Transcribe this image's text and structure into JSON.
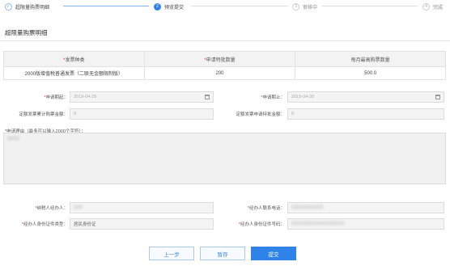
{
  "steps": [
    {
      "num": "✓",
      "label": "超限量购票明细",
      "state": "done"
    },
    {
      "num": "2",
      "label": "预览提交",
      "state": "active"
    },
    {
      "num": "3",
      "label": "审核中",
      "state": "todo"
    },
    {
      "num": "4",
      "label": "完成",
      "state": "todo"
    }
  ],
  "page_title": "超限量购票明细",
  "table": {
    "headers": [
      "发票种类",
      "申请特批数量",
      "每月最高购票数量"
    ],
    "header_required": [
      true,
      true,
      false
    ],
    "rows": [
      [
        "2000版增值税普通发票（二联无金额限制版）",
        "200",
        "500.0"
      ]
    ]
  },
  "form": {
    "apply_start_label": "申请期起：",
    "apply_start_value": "2019-04-29",
    "apply_end_label": "申请期止：",
    "apply_end_value": "2019-04-30",
    "fixed_total_label": "定额发票累计购票金额：",
    "fixed_total_value": "0",
    "fixed_apply_label": "定额发票申请特批金额：",
    "fixed_apply_value": "0",
    "reason_label": "*申请理由（最多可以输入2000个字符）：",
    "reason_value": "XXXX",
    "agent_label": "纳税人经办人：",
    "agent_value": "XXX",
    "agent_phone_label": "经办人联系电话：",
    "agent_phone_value": "13XXXXXXXXX",
    "id_type_label": "经办人身份证件类型：",
    "id_type_value": "居民身份证",
    "id_number_label": "经办人身份证件号码：",
    "id_number_value": "3XXXXXXXXXXXXXXXXX"
  },
  "buttons": {
    "prev": "上一步",
    "save": "暂存",
    "submit": "提交"
  }
}
